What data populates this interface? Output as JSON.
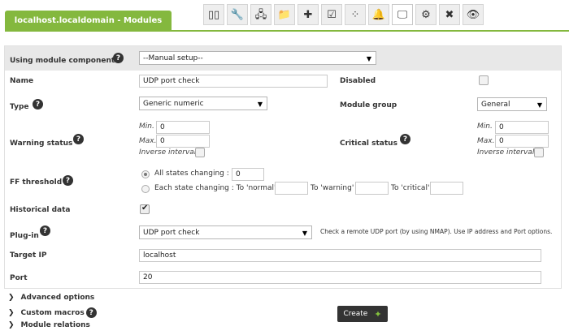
{
  "header": {
    "title": "localhost.localdomain - Modules"
  },
  "toolbar": {
    "items": [
      {
        "name": "manage-icon",
        "glyph": "▯▯"
      },
      {
        "name": "wrench-icon",
        "glyph": "🔧"
      },
      {
        "name": "network-icon",
        "glyph": "🖧"
      },
      {
        "name": "folder-icon",
        "glyph": "📁"
      },
      {
        "name": "puzzle-icon",
        "glyph": "✚"
      },
      {
        "name": "checklist-icon",
        "glyph": "☑"
      },
      {
        "name": "shapes-icon",
        "glyph": "⁘"
      },
      {
        "name": "bell-icon",
        "glyph": "🔔"
      },
      {
        "name": "monitor-icon",
        "glyph": "🖵"
      },
      {
        "name": "gear-box-icon",
        "glyph": "⚙"
      },
      {
        "name": "tools-icon",
        "glyph": "✖"
      },
      {
        "name": "eye-icon",
        "glyph": "👁"
      }
    ],
    "active_index": 8
  },
  "form": {
    "module_component": {
      "label": "Using module component",
      "value": "--Manual setup--"
    },
    "name": {
      "label": "Name",
      "value": "UDP port check"
    },
    "disabled": {
      "label": "Disabled",
      "checked": false
    },
    "type": {
      "label": "Type",
      "value": "Generic numeric"
    },
    "module_group": {
      "label": "Module group",
      "value": "General"
    },
    "warning": {
      "label": "Warning status",
      "min_label": "Min.",
      "min": "0",
      "max_label": "Max.",
      "max": "0",
      "inverse_label": "Inverse interval"
    },
    "critical": {
      "label": "Critical status",
      "min_label": "Min.",
      "min": "0",
      "max_label": "Max.",
      "max": "0",
      "inverse_label": "Inverse interval"
    },
    "ff_threshold": {
      "label": "FF threshold",
      "all_label": "All states changing :",
      "all_value": "0",
      "each_label": "Each state changing : To 'normal'",
      "to_warning": "To 'warning'",
      "to_critical": "To 'critical'"
    },
    "historical": {
      "label": "Historical data",
      "checked": true
    },
    "plugin": {
      "label": "Plug-in",
      "value": "UDP port check",
      "description": "Check a remote UDP port (by using NMAP). Use IP address and Port options."
    },
    "target_ip": {
      "label": "Target IP",
      "value": "localhost"
    },
    "port": {
      "label": "Port",
      "value": "20"
    }
  },
  "sections": {
    "advanced": "Advanced options",
    "macros": "Custom macros",
    "relations": "Module relations"
  },
  "create_button": {
    "label": "Create"
  },
  "help_glyph": "?",
  "caret_glyph": "▼",
  "arrow_glyph": "❯"
}
